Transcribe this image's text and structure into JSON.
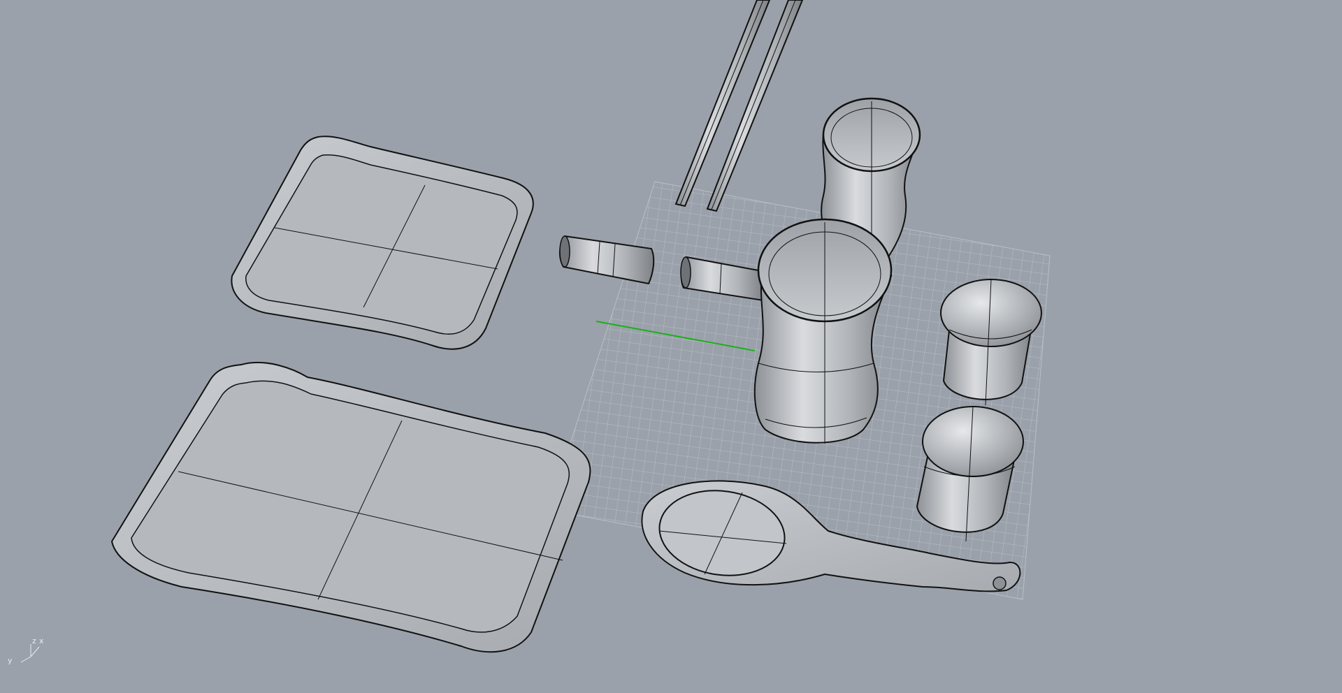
{
  "viewport": {
    "view": "perspective",
    "background_color": "#9aa1aa",
    "grid_color": "#b9c0c7",
    "x_axis_color": "#ff3b3b",
    "y_axis_color": "#19b019",
    "object_fill": "#b2b6bb",
    "wire_color": "#111111",
    "objects": [
      "small-tray",
      "large-tray",
      "chopstick-rest-left",
      "chopstick-rest-right",
      "chopsticks",
      "cup-back",
      "cup-front",
      "salt-shaker",
      "pepper-shaker",
      "ladle-spoon"
    ]
  },
  "axis_widget": {
    "y_label": "y",
    "z_label": "z",
    "x_label": "x"
  }
}
